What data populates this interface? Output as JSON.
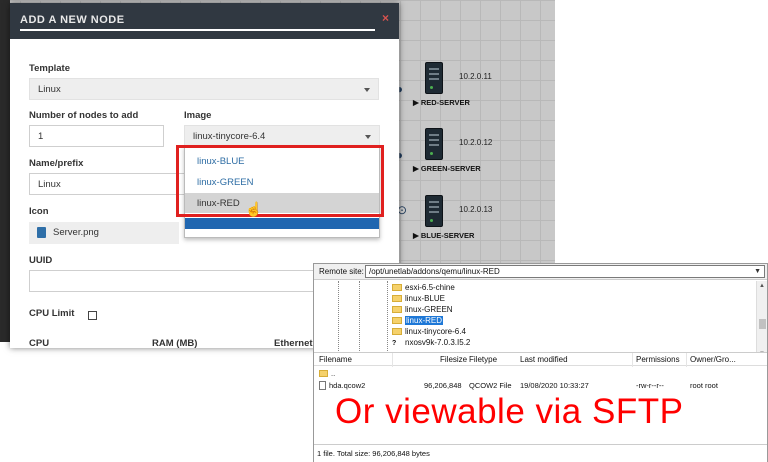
{
  "dialog": {
    "title": "ADD A NEW NODE",
    "close_glyph": "×",
    "template_label": "Template",
    "template_value": "Linux",
    "nodes_label": "Number of nodes to add",
    "nodes_value": "1",
    "image_label": "Image",
    "image_value": "linux-tinycore-6.4",
    "name_label": "Name/prefix",
    "name_value": "Linux",
    "icon_label": "Icon",
    "icon_value": "Server.png",
    "uuid_label": "UUID",
    "cpu_limit_label": "CPU Limit",
    "cpu_label": "CPU",
    "ram_label": "RAM (MB)",
    "ethernet_label": "Ethernet"
  },
  "image_dropdown": {
    "options": [
      "linux-BLUE",
      "linux-GREEN",
      "linux-RED"
    ],
    "hovered": "linux-RED"
  },
  "topology": {
    "nodes": [
      {
        "ip": "10.2.0.11",
        "label": "▶ RED-SERVER"
      },
      {
        "ip": "10.2.0.12",
        "label": "▶ GREEN-SERVER"
      },
      {
        "ip": "10.2.0.13",
        "label": "▶ BLUE-SERVER"
      }
    ]
  },
  "sftp": {
    "remote_site_label": "Remote site:",
    "remote_path": "/opt/unetlab/addons/qemu/linux-RED",
    "tree": [
      "esxi-6.5-chine",
      "linux-BLUE",
      "linux-GREEN",
      "linux-RED",
      "linux-tinycore-6.4",
      "nxosv9k-7.0.3.I5.2"
    ],
    "tree_selected": "linux-RED",
    "columns": [
      "Filename",
      "Filesize",
      "Filetype",
      "Last modified",
      "Permissions",
      "Owner/Gro..."
    ],
    "parent_entry": "..",
    "files": [
      {
        "name": "hda.qcow2",
        "size": "96,206,848",
        "type": "QCOW2 File",
        "modified": "19/08/2020 10:33:27",
        "perms": "-rw-r--r--",
        "owner": "root root"
      }
    ],
    "status": "1 file. Total size: 96,206,848 bytes"
  },
  "caption": "Or viewable via SFTP",
  "colors": {
    "highlight_red": "#e0201f",
    "caption_red": "#ff0000",
    "dialog_header": "#303841",
    "link_blue": "#2e6da4"
  }
}
